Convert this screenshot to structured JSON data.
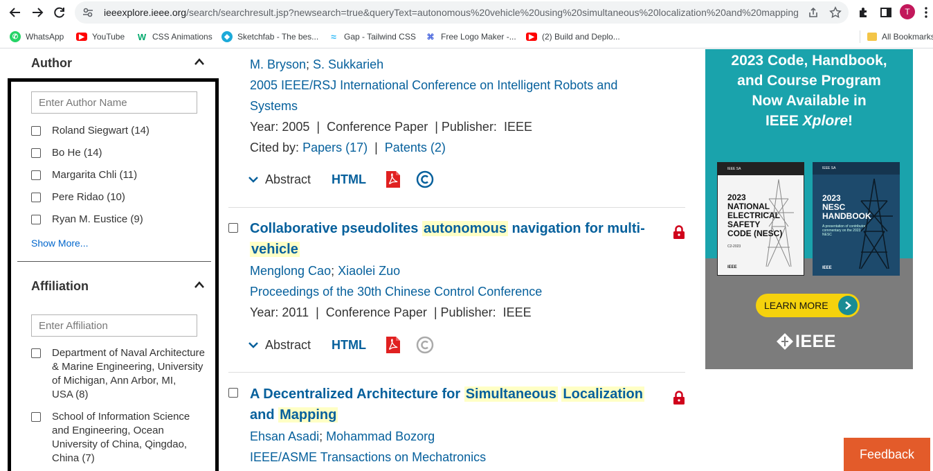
{
  "browser": {
    "url_domain": "ieeexplore.ieee.org",
    "url_path": "/search/searchresult.jsp?newsearch=true&queryText=autonomous%20vehicle%20using%20simultaneous%20localization%20and%20mapping",
    "profile_initial": "T",
    "bookmarks": [
      {
        "label": "WhatsApp",
        "icon": "whatsapp-icon",
        "color": "#25d366"
      },
      {
        "label": "YouTube",
        "icon": "youtube-icon",
        "color": "#ff0000"
      },
      {
        "label": "CSS Animations",
        "icon": "w3schools-icon",
        "color": "#04aa6d"
      },
      {
        "label": "Sketchfab - The bes...",
        "icon": "sketchfab-icon",
        "color": "#1caad9"
      },
      {
        "label": "Gap - Tailwind CSS",
        "icon": "tailwind-icon",
        "color": "#38bdf8"
      },
      {
        "label": "Free Logo Maker -...",
        "icon": "logo-maker-icon",
        "color": "#3b5bdb"
      },
      {
        "label": "(2) Build and Deplo...",
        "icon": "youtube-icon",
        "color": "#ff0000"
      }
    ],
    "all_bookmarks": "All Bookmarks"
  },
  "sidebar": {
    "author": {
      "title": "Author",
      "placeholder": "Enter Author Name",
      "items": [
        "Roland Siegwart (14)",
        "Bo He (14)",
        "Margarita Chli (11)",
        "Pere Ridao (10)",
        "Ryan M. Eustice (9)"
      ],
      "show_more": "Show More..."
    },
    "affiliation": {
      "title": "Affiliation",
      "placeholder": "Enter Affiliation",
      "items": [
        [
          "Department of Naval Architecture",
          "& Marine Engineering, University",
          "of Michigan, Ann Arbor, MI,",
          "USA (8)"
        ],
        [
          "School of Information Science",
          "and Engineering, Ocean",
          "University of China, Qingdao,",
          "China (7)"
        ]
      ]
    }
  },
  "results": {
    "r0": {
      "authors": [
        "M. Bryson",
        "S. Sukkarieh"
      ],
      "venue_line1": "2005 IEEE/RSJ International Conference on Intelligent Robots and",
      "venue_line2": "Systems",
      "year_label": "Year: 2005",
      "type": "Conference Paper",
      "publisher_label": "Publisher:",
      "publisher": "IEEE",
      "cited_by_label": "Cited by:",
      "papers": "Papers (17)",
      "patents": "Patents (2)"
    },
    "r1": {
      "title_parts": [
        "Collaborative pseudolites ",
        "autonomous",
        " navigation for multi-",
        "vehicle"
      ],
      "authors": [
        "Menglong Cao",
        "Xiaolei Zuo"
      ],
      "venue": "Proceedings of the 30th Chinese Control Conference",
      "year_label": "Year: 2011",
      "type": "Conference Paper",
      "publisher_label": "Publisher:",
      "publisher": "IEEE"
    },
    "r2": {
      "title_parts": [
        "A Decentralized Architecture for ",
        "Simultaneous",
        "Localization",
        "and ",
        "Mapping"
      ],
      "authors": [
        "Ehsan Asadi",
        "Mohammad Bozorg"
      ],
      "venue": "IEEE/ASME Transactions on Mechatronics"
    },
    "abstract_label": "Abstract",
    "html_label": "HTML"
  },
  "ad": {
    "headline_lines": [
      "2023 Code, Handbook,",
      "and Course Program",
      "Now Available in"
    ],
    "headline_last_prefix": "IEEE ",
    "headline_last_italic": "Xplore",
    "headline_last_suffix": "!",
    "book1": {
      "brand": "IEEE SA",
      "title_lines": [
        "2023",
        "NATIONAL",
        "ELECTRICAL",
        "SAFETY",
        "CODE (NESC)"
      ],
      "sub": "C2-2023"
    },
    "book2": {
      "brand": "IEEE SA",
      "title_lines": [
        "2023",
        "NESC",
        "HANDBOOK"
      ],
      "sub": "A presentation of contributor commentary on the 2023 NESC"
    },
    "book_logo": "IEEE",
    "cta": "LEARN MORE",
    "logo": "IEEE",
    "colors": {
      "teal": "#1aa3ac",
      "gray": "#7c7c7c",
      "cta": "#f5d20d"
    }
  },
  "feedback": "Feedback",
  "colors": {
    "link": "#06609c",
    "highlight": "#ffffc5",
    "lock": "#d0021b",
    "pdf": "#e02020"
  }
}
